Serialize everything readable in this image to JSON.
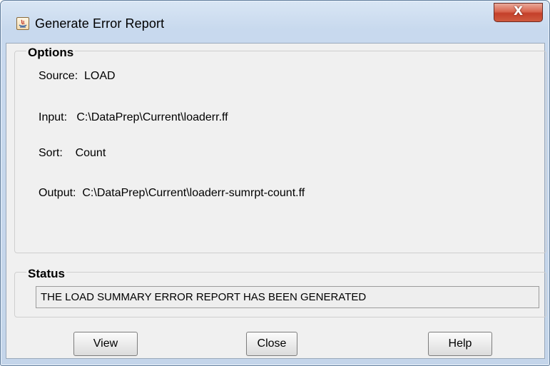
{
  "window": {
    "title": "Generate Error Report",
    "close_glyph": "X"
  },
  "options": {
    "heading": "Options",
    "source": "Source:  LOAD",
    "input": "Input:   C:\\DataPrep\\Current\\loaderr.ff",
    "sort": "Sort:    Count",
    "output": "Output:  C:\\DataPrep\\Current\\loaderr-sumrpt-count.ff"
  },
  "status": {
    "heading": "Status",
    "message": "THE LOAD SUMMARY ERROR REPORT HAS BEEN GENERATED"
  },
  "buttons": {
    "view": "View",
    "close": "Close",
    "help": "Help"
  }
}
